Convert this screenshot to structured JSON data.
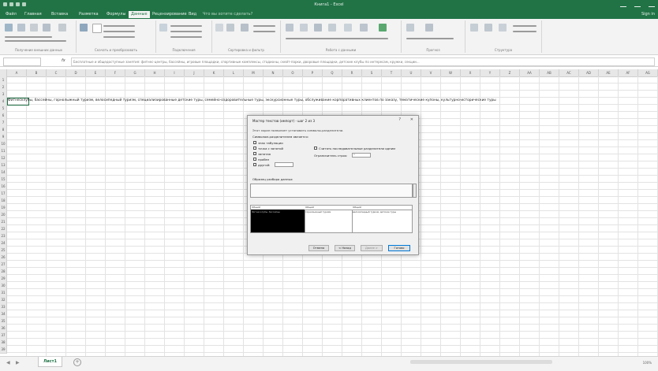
{
  "titlebar": {
    "title": "Книга1 - Excel",
    "account": "Sign in"
  },
  "ribbon_tabs": [
    {
      "label": "Файл"
    },
    {
      "label": "Главная"
    },
    {
      "label": "Вставка"
    },
    {
      "label": "Разметка"
    },
    {
      "label": "Формулы"
    },
    {
      "label": "Данные"
    },
    {
      "label": "Рецензирование"
    },
    {
      "label": "Вид"
    },
    {
      "label": "Что вы хотите сделать?"
    }
  ],
  "ribbon_groups": [
    {
      "label": "Получение внешних данных"
    },
    {
      "label": "Скачать и преобразовать"
    },
    {
      "label": "Подключения"
    },
    {
      "label": "Сортировка и фильтр"
    },
    {
      "label": "Работа с данными"
    },
    {
      "label": "Прогноз"
    },
    {
      "label": "Структура"
    }
  ],
  "formula_bar": {
    "namebox": "A1",
    "fx": "fx",
    "content": "Бесплатные и общедоступные занятия: фитнес-центры, бассейны, игровые площадки, спортивные комплексы, стадионы, скейт-парки, дворовые площадки, детские клубы по интересам, кружки, секции..."
  },
  "columns": [
    "A",
    "B",
    "C",
    "D",
    "E",
    "F",
    "G",
    "H",
    "I",
    "J",
    "K",
    "L",
    "M",
    "N",
    "O",
    "P",
    "Q",
    "R",
    "S",
    "T",
    "U",
    "V",
    "W",
    "X",
    "Y",
    "Z",
    "AA",
    "AB",
    "AC",
    "AD",
    "AE",
    "AF",
    "AG"
  ],
  "cell_a1": "Фитнесклубы, бассейны, горнолыжный туризм, велосипедный туризм, специализированные детские туры, семейно-оздоровительные туры, экскурсионные туры, обслуживание корпоративных клиентов по заказу, тематические купоны, культурно-исторические туры",
  "sheet": {
    "tab": "Лист1",
    "add": "+",
    "status": "100%"
  },
  "dialog": {
    "title": "Мастер текстов (импорт) - шаг 2 из 3",
    "help": "?",
    "close": "✕",
    "intro": "Этот экран позволяет установить символы-разделители.",
    "delim_label": "Символом-разделителем является:",
    "options": [
      "знак табуляции",
      "точка с запятой",
      "запятая",
      "пробел",
      "другой:"
    ],
    "other_value": "",
    "treat_consecutive": "Считать последовательные разделители одним",
    "qualifier_label": "Ограничитель строк:",
    "qualifier_value": "\"",
    "sample_label": "Образец разбора данных",
    "preview_cols": [
      {
        "head": "Общий",
        "cell": "Фитнесклубы, бассейны"
      },
      {
        "head": "Общий",
        "cell": "горнолыжный туризм"
      },
      {
        "head": "Общий",
        "cell": "велосипедный туризм, детские туры"
      }
    ],
    "buttons": {
      "cancel": "Отмена",
      "back": "< Назад",
      "next": "Далее >",
      "finish": "Готово"
    }
  }
}
